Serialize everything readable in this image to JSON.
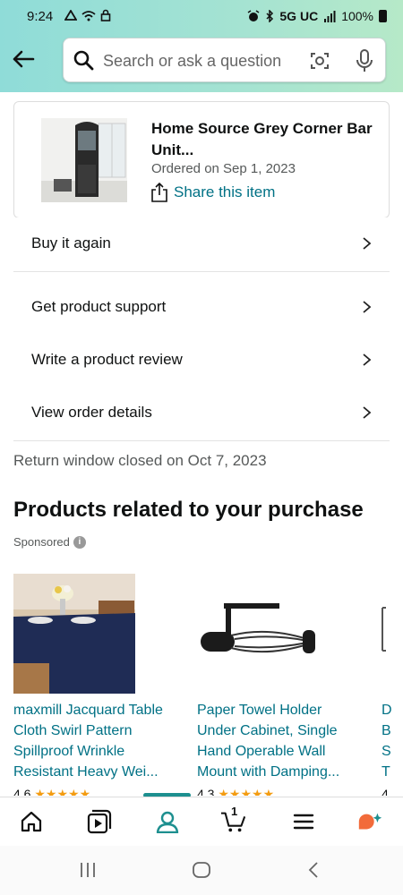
{
  "status_bar": {
    "time": "9:24",
    "network": "5G UC",
    "battery": "100%"
  },
  "search": {
    "placeholder": "Search or ask a question"
  },
  "order": {
    "product_title": "Home Source Grey Corner Bar Unit...",
    "ordered_on": "Ordered on Sep 1, 2023",
    "share_label": "Share this item"
  },
  "actions": [
    {
      "label": "Buy it again"
    },
    {
      "label": "Get product support"
    },
    {
      "label": "Write a product review"
    },
    {
      "label": "View order details"
    }
  ],
  "return_window": "Return window closed on Oct 7, 2023",
  "related": {
    "title": "Products related to your purchase",
    "sponsored": "Sponsored",
    "products": [
      {
        "title_lines": [
          "maxmill Jacquard Table",
          "Cloth Swirl Pattern",
          "Spillproof Wrinkle",
          "Resistant Heavy Wei..."
        ],
        "rating": "4.6"
      },
      {
        "title_lines": [
          "Paper Towel Holder",
          "Under Cabinet, Single",
          "Hand Operable Wall",
          "Mount with Damping..."
        ],
        "rating": "4.3"
      },
      {
        "title_lines": [
          "D",
          "B",
          "S",
          "T"
        ],
        "rating": "4"
      }
    ]
  },
  "bottom_nav": {
    "cart_count": "1",
    "active_tab": "account"
  },
  "colors": {
    "header_gradient_start": "#8fdcd8",
    "header_gradient_end": "#b6e9c8",
    "link": "#007185",
    "star": "#f39c12",
    "active_indicator": "#1d8f8f"
  }
}
